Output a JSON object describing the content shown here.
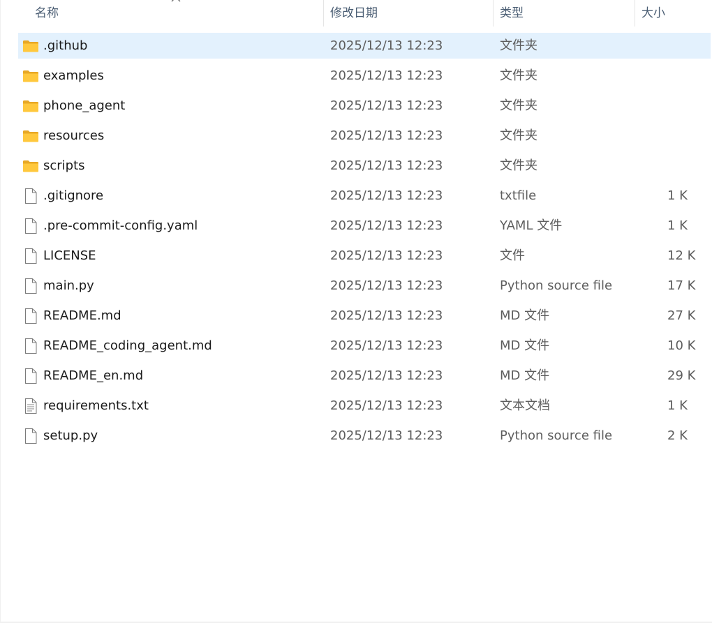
{
  "columns": {
    "name": "名称",
    "date": "修改日期",
    "type": "类型",
    "size": "大小"
  },
  "sort": {
    "column": "name",
    "indicator": "chevron-up-icon"
  },
  "colors": {
    "selection": "#e3f1fd",
    "folder": "#ffc83d",
    "header_text": "#4a5d73",
    "secondary_text": "#5d5d5d"
  },
  "files": [
    {
      "name": ".github",
      "date": "2025/12/13 12:23",
      "type": "文件夹",
      "size": "",
      "icon": "folder-icon",
      "selected": true
    },
    {
      "name": "examples",
      "date": "2025/12/13 12:23",
      "type": "文件夹",
      "size": "",
      "icon": "folder-icon"
    },
    {
      "name": "phone_agent",
      "date": "2025/12/13 12:23",
      "type": "文件夹",
      "size": "",
      "icon": "folder-icon"
    },
    {
      "name": "resources",
      "date": "2025/12/13 12:23",
      "type": "文件夹",
      "size": "",
      "icon": "folder-icon"
    },
    {
      "name": "scripts",
      "date": "2025/12/13 12:23",
      "type": "文件夹",
      "size": "",
      "icon": "folder-icon"
    },
    {
      "name": ".gitignore",
      "date": "2025/12/13 12:23",
      "type": "txtfile",
      "size": "1 K",
      "icon": "file-icon"
    },
    {
      "name": ".pre-commit-config.yaml",
      "date": "2025/12/13 12:23",
      "type": "YAML 文件",
      "size": "1 K",
      "icon": "file-icon"
    },
    {
      "name": "LICENSE",
      "date": "2025/12/13 12:23",
      "type": "文件",
      "size": "12 K",
      "icon": "file-icon"
    },
    {
      "name": "main.py",
      "date": "2025/12/13 12:23",
      "type": "Python source file",
      "size": "17 K",
      "icon": "file-icon"
    },
    {
      "name": "README.md",
      "date": "2025/12/13 12:23",
      "type": "MD 文件",
      "size": "27 K",
      "icon": "file-icon"
    },
    {
      "name": "README_coding_agent.md",
      "date": "2025/12/13 12:23",
      "type": "MD 文件",
      "size": "10 K",
      "icon": "file-icon"
    },
    {
      "name": "README_en.md",
      "date": "2025/12/13 12:23",
      "type": "MD 文件",
      "size": "29 K",
      "icon": "file-icon"
    },
    {
      "name": "requirements.txt",
      "date": "2025/12/13 12:23",
      "type": "文本文档",
      "size": "1 K",
      "icon": "text-document-icon"
    },
    {
      "name": "setup.py",
      "date": "2025/12/13 12:23",
      "type": "Python source file",
      "size": "2 K",
      "icon": "file-icon"
    }
  ]
}
